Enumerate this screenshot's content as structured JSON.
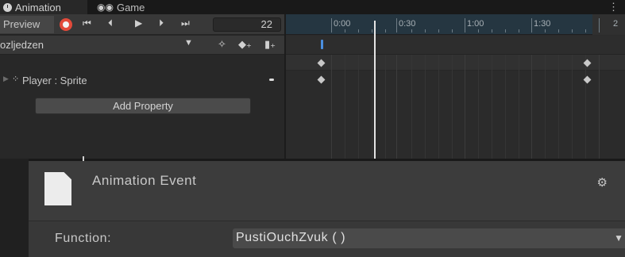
{
  "tabs": {
    "animation": {
      "label": "Animation",
      "icon": "clock-icon"
    },
    "game": {
      "label": "Game",
      "icon": "gamepad-icon"
    },
    "menu_icon": "window-menu-icon"
  },
  "toolbar": {
    "preview_label": "Preview",
    "record_icon": "record-icon",
    "first_key_glyph": "⏮",
    "prev_key_glyph": "⏴",
    "play_glyph": "▶",
    "next_key_glyph": "⏵",
    "last_key_glyph": "⏭",
    "frame_value": "22"
  },
  "clip": {
    "name": "ozljedzen",
    "add_keyframe_icon": "add-keyframe-icon",
    "add_event_icon": "add-event-icon",
    "filter_icon": "filter-keys-icon"
  },
  "properties": [
    {
      "label": "Player : Sprite",
      "icon": "sprite-icon"
    }
  ],
  "add_property_label": "Add Property",
  "timeline": {
    "ruler_labels": [
      "0:00",
      "0:30",
      "1:00",
      "1:30",
      "2"
    ],
    "colors": {
      "ruler": "#253641",
      "playhead": "#e4e4e4",
      "event_marker": "#4a8fe0"
    }
  },
  "inspector": {
    "title": "Animation Event",
    "function_label": "Function:",
    "function_value": "PustiOuchZvuk ( )",
    "settings_icon": "settings-sliders-icon"
  }
}
